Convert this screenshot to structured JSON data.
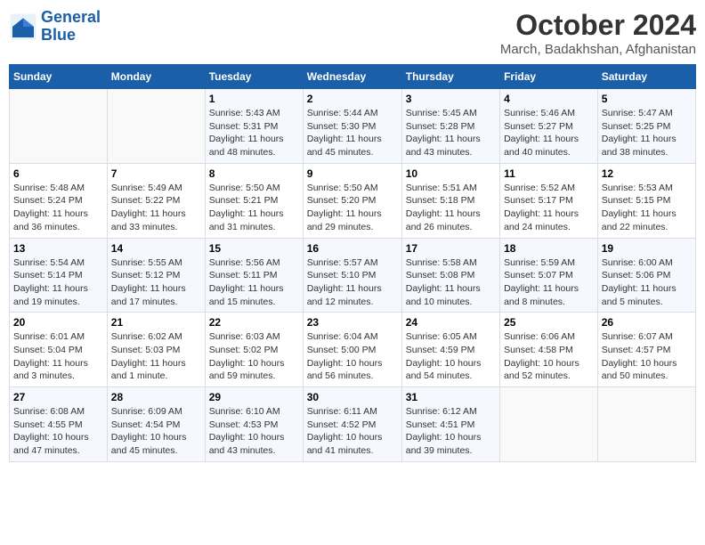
{
  "logo": {
    "line1": "General",
    "line2": "Blue"
  },
  "title": "October 2024",
  "subtitle": "March, Badakhshan, Afghanistan",
  "days_header": [
    "Sunday",
    "Monday",
    "Tuesday",
    "Wednesday",
    "Thursday",
    "Friday",
    "Saturday"
  ],
  "weeks": [
    [
      {
        "day": "",
        "sunrise": "",
        "sunset": "",
        "daylight": ""
      },
      {
        "day": "",
        "sunrise": "",
        "sunset": "",
        "daylight": ""
      },
      {
        "day": "1",
        "sunrise": "Sunrise: 5:43 AM",
        "sunset": "Sunset: 5:31 PM",
        "daylight": "Daylight: 11 hours and 48 minutes."
      },
      {
        "day": "2",
        "sunrise": "Sunrise: 5:44 AM",
        "sunset": "Sunset: 5:30 PM",
        "daylight": "Daylight: 11 hours and 45 minutes."
      },
      {
        "day": "3",
        "sunrise": "Sunrise: 5:45 AM",
        "sunset": "Sunset: 5:28 PM",
        "daylight": "Daylight: 11 hours and 43 minutes."
      },
      {
        "day": "4",
        "sunrise": "Sunrise: 5:46 AM",
        "sunset": "Sunset: 5:27 PM",
        "daylight": "Daylight: 11 hours and 40 minutes."
      },
      {
        "day": "5",
        "sunrise": "Sunrise: 5:47 AM",
        "sunset": "Sunset: 5:25 PM",
        "daylight": "Daylight: 11 hours and 38 minutes."
      }
    ],
    [
      {
        "day": "6",
        "sunrise": "Sunrise: 5:48 AM",
        "sunset": "Sunset: 5:24 PM",
        "daylight": "Daylight: 11 hours and 36 minutes."
      },
      {
        "day": "7",
        "sunrise": "Sunrise: 5:49 AM",
        "sunset": "Sunset: 5:22 PM",
        "daylight": "Daylight: 11 hours and 33 minutes."
      },
      {
        "day": "8",
        "sunrise": "Sunrise: 5:50 AM",
        "sunset": "Sunset: 5:21 PM",
        "daylight": "Daylight: 11 hours and 31 minutes."
      },
      {
        "day": "9",
        "sunrise": "Sunrise: 5:50 AM",
        "sunset": "Sunset: 5:20 PM",
        "daylight": "Daylight: 11 hours and 29 minutes."
      },
      {
        "day": "10",
        "sunrise": "Sunrise: 5:51 AM",
        "sunset": "Sunset: 5:18 PM",
        "daylight": "Daylight: 11 hours and 26 minutes."
      },
      {
        "day": "11",
        "sunrise": "Sunrise: 5:52 AM",
        "sunset": "Sunset: 5:17 PM",
        "daylight": "Daylight: 11 hours and 24 minutes."
      },
      {
        "day": "12",
        "sunrise": "Sunrise: 5:53 AM",
        "sunset": "Sunset: 5:15 PM",
        "daylight": "Daylight: 11 hours and 22 minutes."
      }
    ],
    [
      {
        "day": "13",
        "sunrise": "Sunrise: 5:54 AM",
        "sunset": "Sunset: 5:14 PM",
        "daylight": "Daylight: 11 hours and 19 minutes."
      },
      {
        "day": "14",
        "sunrise": "Sunrise: 5:55 AM",
        "sunset": "Sunset: 5:12 PM",
        "daylight": "Daylight: 11 hours and 17 minutes."
      },
      {
        "day": "15",
        "sunrise": "Sunrise: 5:56 AM",
        "sunset": "Sunset: 5:11 PM",
        "daylight": "Daylight: 11 hours and 15 minutes."
      },
      {
        "day": "16",
        "sunrise": "Sunrise: 5:57 AM",
        "sunset": "Sunset: 5:10 PM",
        "daylight": "Daylight: 11 hours and 12 minutes."
      },
      {
        "day": "17",
        "sunrise": "Sunrise: 5:58 AM",
        "sunset": "Sunset: 5:08 PM",
        "daylight": "Daylight: 11 hours and 10 minutes."
      },
      {
        "day": "18",
        "sunrise": "Sunrise: 5:59 AM",
        "sunset": "Sunset: 5:07 PM",
        "daylight": "Daylight: 11 hours and 8 minutes."
      },
      {
        "day": "19",
        "sunrise": "Sunrise: 6:00 AM",
        "sunset": "Sunset: 5:06 PM",
        "daylight": "Daylight: 11 hours and 5 minutes."
      }
    ],
    [
      {
        "day": "20",
        "sunrise": "Sunrise: 6:01 AM",
        "sunset": "Sunset: 5:04 PM",
        "daylight": "Daylight: 11 hours and 3 minutes."
      },
      {
        "day": "21",
        "sunrise": "Sunrise: 6:02 AM",
        "sunset": "Sunset: 5:03 PM",
        "daylight": "Daylight: 11 hours and 1 minute."
      },
      {
        "day": "22",
        "sunrise": "Sunrise: 6:03 AM",
        "sunset": "Sunset: 5:02 PM",
        "daylight": "Daylight: 10 hours and 59 minutes."
      },
      {
        "day": "23",
        "sunrise": "Sunrise: 6:04 AM",
        "sunset": "Sunset: 5:00 PM",
        "daylight": "Daylight: 10 hours and 56 minutes."
      },
      {
        "day": "24",
        "sunrise": "Sunrise: 6:05 AM",
        "sunset": "Sunset: 4:59 PM",
        "daylight": "Daylight: 10 hours and 54 minutes."
      },
      {
        "day": "25",
        "sunrise": "Sunrise: 6:06 AM",
        "sunset": "Sunset: 4:58 PM",
        "daylight": "Daylight: 10 hours and 52 minutes."
      },
      {
        "day": "26",
        "sunrise": "Sunrise: 6:07 AM",
        "sunset": "Sunset: 4:57 PM",
        "daylight": "Daylight: 10 hours and 50 minutes."
      }
    ],
    [
      {
        "day": "27",
        "sunrise": "Sunrise: 6:08 AM",
        "sunset": "Sunset: 4:55 PM",
        "daylight": "Daylight: 10 hours and 47 minutes."
      },
      {
        "day": "28",
        "sunrise": "Sunrise: 6:09 AM",
        "sunset": "Sunset: 4:54 PM",
        "daylight": "Daylight: 10 hours and 45 minutes."
      },
      {
        "day": "29",
        "sunrise": "Sunrise: 6:10 AM",
        "sunset": "Sunset: 4:53 PM",
        "daylight": "Daylight: 10 hours and 43 minutes."
      },
      {
        "day": "30",
        "sunrise": "Sunrise: 6:11 AM",
        "sunset": "Sunset: 4:52 PM",
        "daylight": "Daylight: 10 hours and 41 minutes."
      },
      {
        "day": "31",
        "sunrise": "Sunrise: 6:12 AM",
        "sunset": "Sunset: 4:51 PM",
        "daylight": "Daylight: 10 hours and 39 minutes."
      },
      {
        "day": "",
        "sunrise": "",
        "sunset": "",
        "daylight": ""
      },
      {
        "day": "",
        "sunrise": "",
        "sunset": "",
        "daylight": ""
      }
    ]
  ]
}
